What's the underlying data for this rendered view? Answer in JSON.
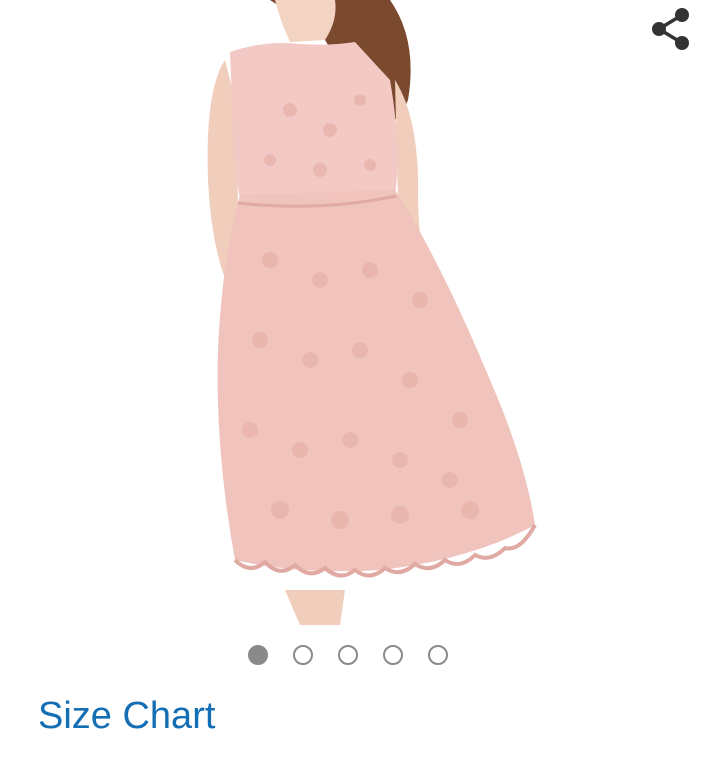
{
  "share": {
    "icon": "share-icon"
  },
  "product": {
    "image": "pink-lace-sleeveless-dress",
    "dress_color": "#f2c9c4"
  },
  "carousel": {
    "count": 5,
    "active_index": 0,
    "icon": "dot-indicator"
  },
  "size_chart": {
    "label": "Size Chart",
    "color": "#146eb4"
  }
}
